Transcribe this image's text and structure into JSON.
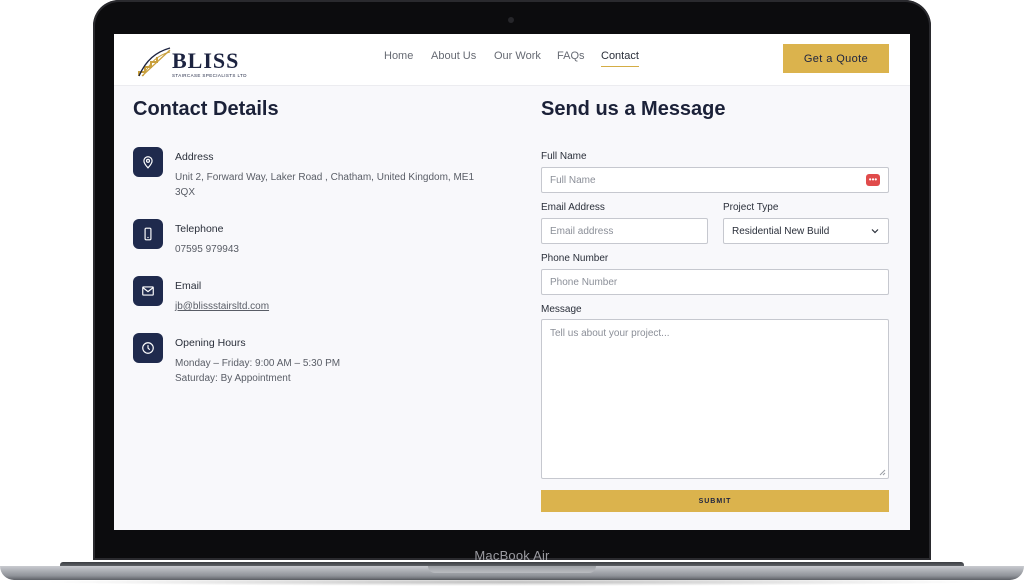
{
  "device": {
    "label": "MacBook Air"
  },
  "header": {
    "logo_word": "BLISS",
    "logo_sub": "STAIRCASE SPECIALISTS LTD",
    "nav": [
      {
        "label": "Home"
      },
      {
        "label": "About Us"
      },
      {
        "label": "Our Work"
      },
      {
        "label": "FAQs"
      },
      {
        "label": "Contact",
        "active": true
      }
    ],
    "cta_label": "Get a Quote"
  },
  "contact": {
    "title": "Contact Details",
    "address": {
      "label": "Address",
      "line1": "Unit 2, Forward Way, Laker Road , Chatham, United Kingdom, ME1",
      "line2": "3QX",
      "icon": "location-pin-icon"
    },
    "telephone": {
      "label": "Telephone",
      "value": "07595 979943",
      "icon": "phone-icon"
    },
    "email": {
      "label": "Email",
      "value": "jb@blissstairsltd.com",
      "icon": "mail-icon"
    },
    "hours": {
      "label": "Opening Hours",
      "line1": "Monday – Friday: 9:00 AM – 5:30 PM",
      "line2": "Saturday: By Appointment",
      "icon": "clock-icon"
    }
  },
  "form": {
    "title": "Send us a Message",
    "full_name": {
      "label": "Full Name",
      "placeholder": "Full Name"
    },
    "email": {
      "label": "Email Address",
      "placeholder": "Email address"
    },
    "project_type": {
      "label": "Project Type",
      "value": "Residential New Build"
    },
    "phone": {
      "label": "Phone Number",
      "placeholder": "Phone Number"
    },
    "message": {
      "label": "Message",
      "placeholder": "Tell us about your project..."
    },
    "submit_label": "SUBMIT"
  },
  "colors": {
    "accent": "#dbb34d",
    "navy": "#1f2a4d",
    "background": "#f8f8fb"
  }
}
